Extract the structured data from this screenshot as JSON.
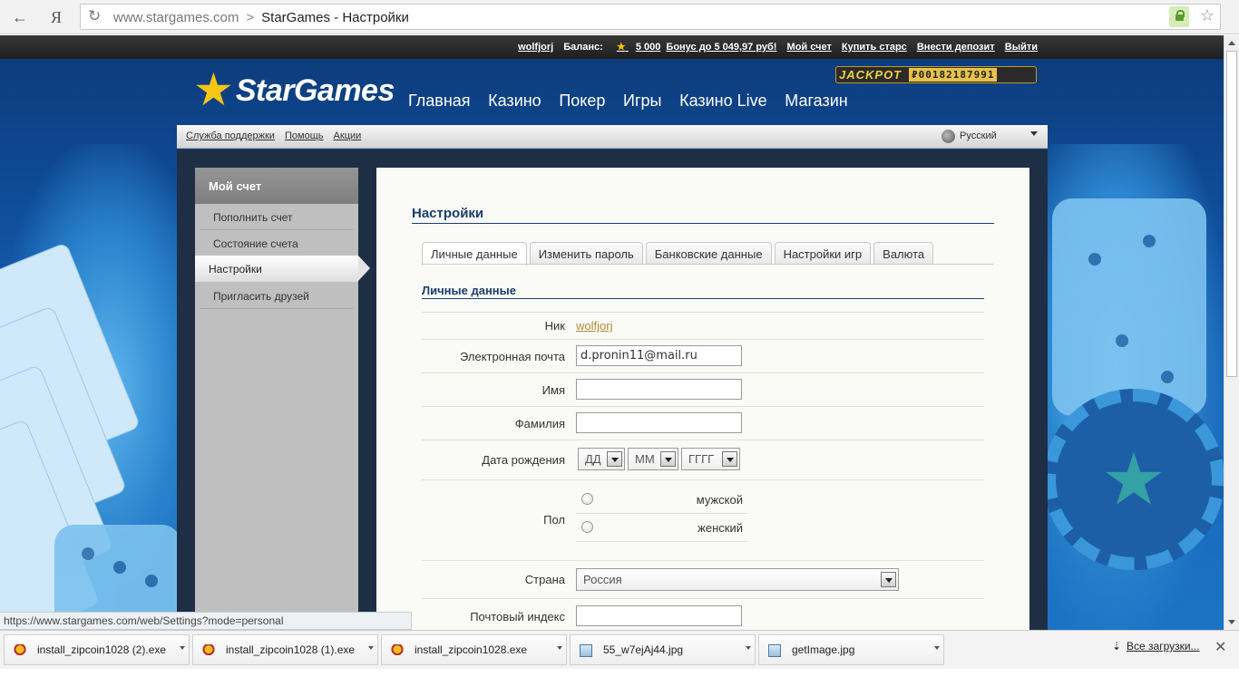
{
  "browser": {
    "url_host": "www.stargames.com",
    "separator": ">",
    "page_title": "StarGames - Настройки",
    "yandex_label": "Я"
  },
  "topbar": {
    "user": "wolfjorj",
    "balance_label": "Баланс:",
    "stars_icon": "★",
    "balance_value": "5 000",
    "bonus": "Бонус до 5 049,97 руб!",
    "my_account": "Мой счет",
    "buy_stars": "Купить старс",
    "deposit": "Внести депозит",
    "logout": "Выйти"
  },
  "header": {
    "logo_text": "StarGames",
    "jackpot_label": "JACKPOT",
    "jackpot_value": "₽00182187991",
    "nav": [
      "Главная",
      "Казино",
      "Покер",
      "Игры",
      "Казино Live",
      "Магазин"
    ]
  },
  "subbar": {
    "links": [
      "Служба поддержки",
      "Помощь",
      "Акции"
    ],
    "language": "Русский"
  },
  "sidebar": {
    "title": "Мой счет",
    "items": [
      {
        "label": "Пополнить счет"
      },
      {
        "label": "Состояние счета"
      },
      {
        "label": "Настройки"
      },
      {
        "label": "Пригласить друзей"
      }
    ]
  },
  "panel": {
    "title": "Настройки",
    "tabs": [
      "Личные данные",
      "Изменить пароль",
      "Банковские данные",
      "Настройки игр",
      "Валюта"
    ],
    "section_title": "Личные данные",
    "fields": {
      "nick_label": "Ник",
      "nick_value": "wolfjorj",
      "email_label": "Электронная почта",
      "email_value": "d.pronin11@mail.ru",
      "first_name_label": "Имя",
      "last_name_label": "Фамилия",
      "dob_label": "Дата рождения",
      "dob_day": "ДД",
      "dob_month": "ММ",
      "dob_year": "ГГГГ",
      "gender_label": "Пол",
      "gender_male": "мужской",
      "gender_female": "женский",
      "country_label": "Страна",
      "country_value": "Россия",
      "postal_label": "Почтовый индекс"
    }
  },
  "status_bar": "https://www.stargames.com/web/Settings?mode=personal",
  "downloads": {
    "items": [
      {
        "name": "install_zipcoin1028 (2).exe",
        "type": "exe"
      },
      {
        "name": "install_zipcoin1028 (1).exe",
        "type": "exe"
      },
      {
        "name": "install_zipcoin1028.exe",
        "type": "exe"
      },
      {
        "name": "55_w7ejAj44.jpg",
        "type": "image"
      },
      {
        "name": "getImage.jpg",
        "type": "image"
      }
    ],
    "all_downloads": "Все загрузки...",
    "close": "✕"
  },
  "colors": {
    "accent_blue": "#1b3d6e",
    "gold": "#f6c614"
  }
}
